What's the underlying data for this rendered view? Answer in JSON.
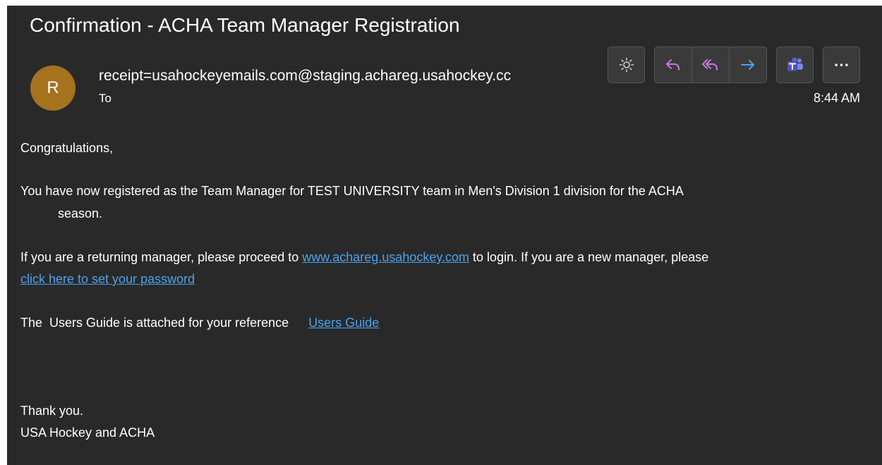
{
  "email": {
    "subject": "Confirmation - ACHA Team Manager Registration",
    "avatar_initial": "R",
    "avatar_color": "#a5721e",
    "sender": "receipt=usahockeyemails.com@staging.achareg.usahockey.cc",
    "to_label": "To",
    "time": "8:44 AM"
  },
  "toolbar": {
    "icons": [
      "brightness-icon",
      "reply-icon",
      "reply-all-icon",
      "forward-icon",
      "teams-icon",
      "more-icon"
    ],
    "more_label": "⋯"
  },
  "body": {
    "greeting": "Congratulations,",
    "registration_line1": "You have now registered as the Team Manager for TEST UNIVERSITY team in Men's Division 1 division for the ACHA",
    "registration_line2": "season.",
    "returning_prefix": "If you are a returning manager, please proceed to ",
    "returning_link": "www.achareg.usahockey.com",
    "returning_suffix": " to login. If you are a new manager, please",
    "password_link": "click here to set your password",
    "guide_text": "The  Users Guide is attached for your reference",
    "guide_link": "Users Guide",
    "thanks": "Thank you.",
    "signature": "USA Hockey and ACHA"
  },
  "colors": {
    "background": "#292929",
    "link": "#4aa3ee",
    "reply_icons": "#c678dd",
    "forward_icon": "#4aa3ee",
    "teams": "#5b5fc7"
  }
}
